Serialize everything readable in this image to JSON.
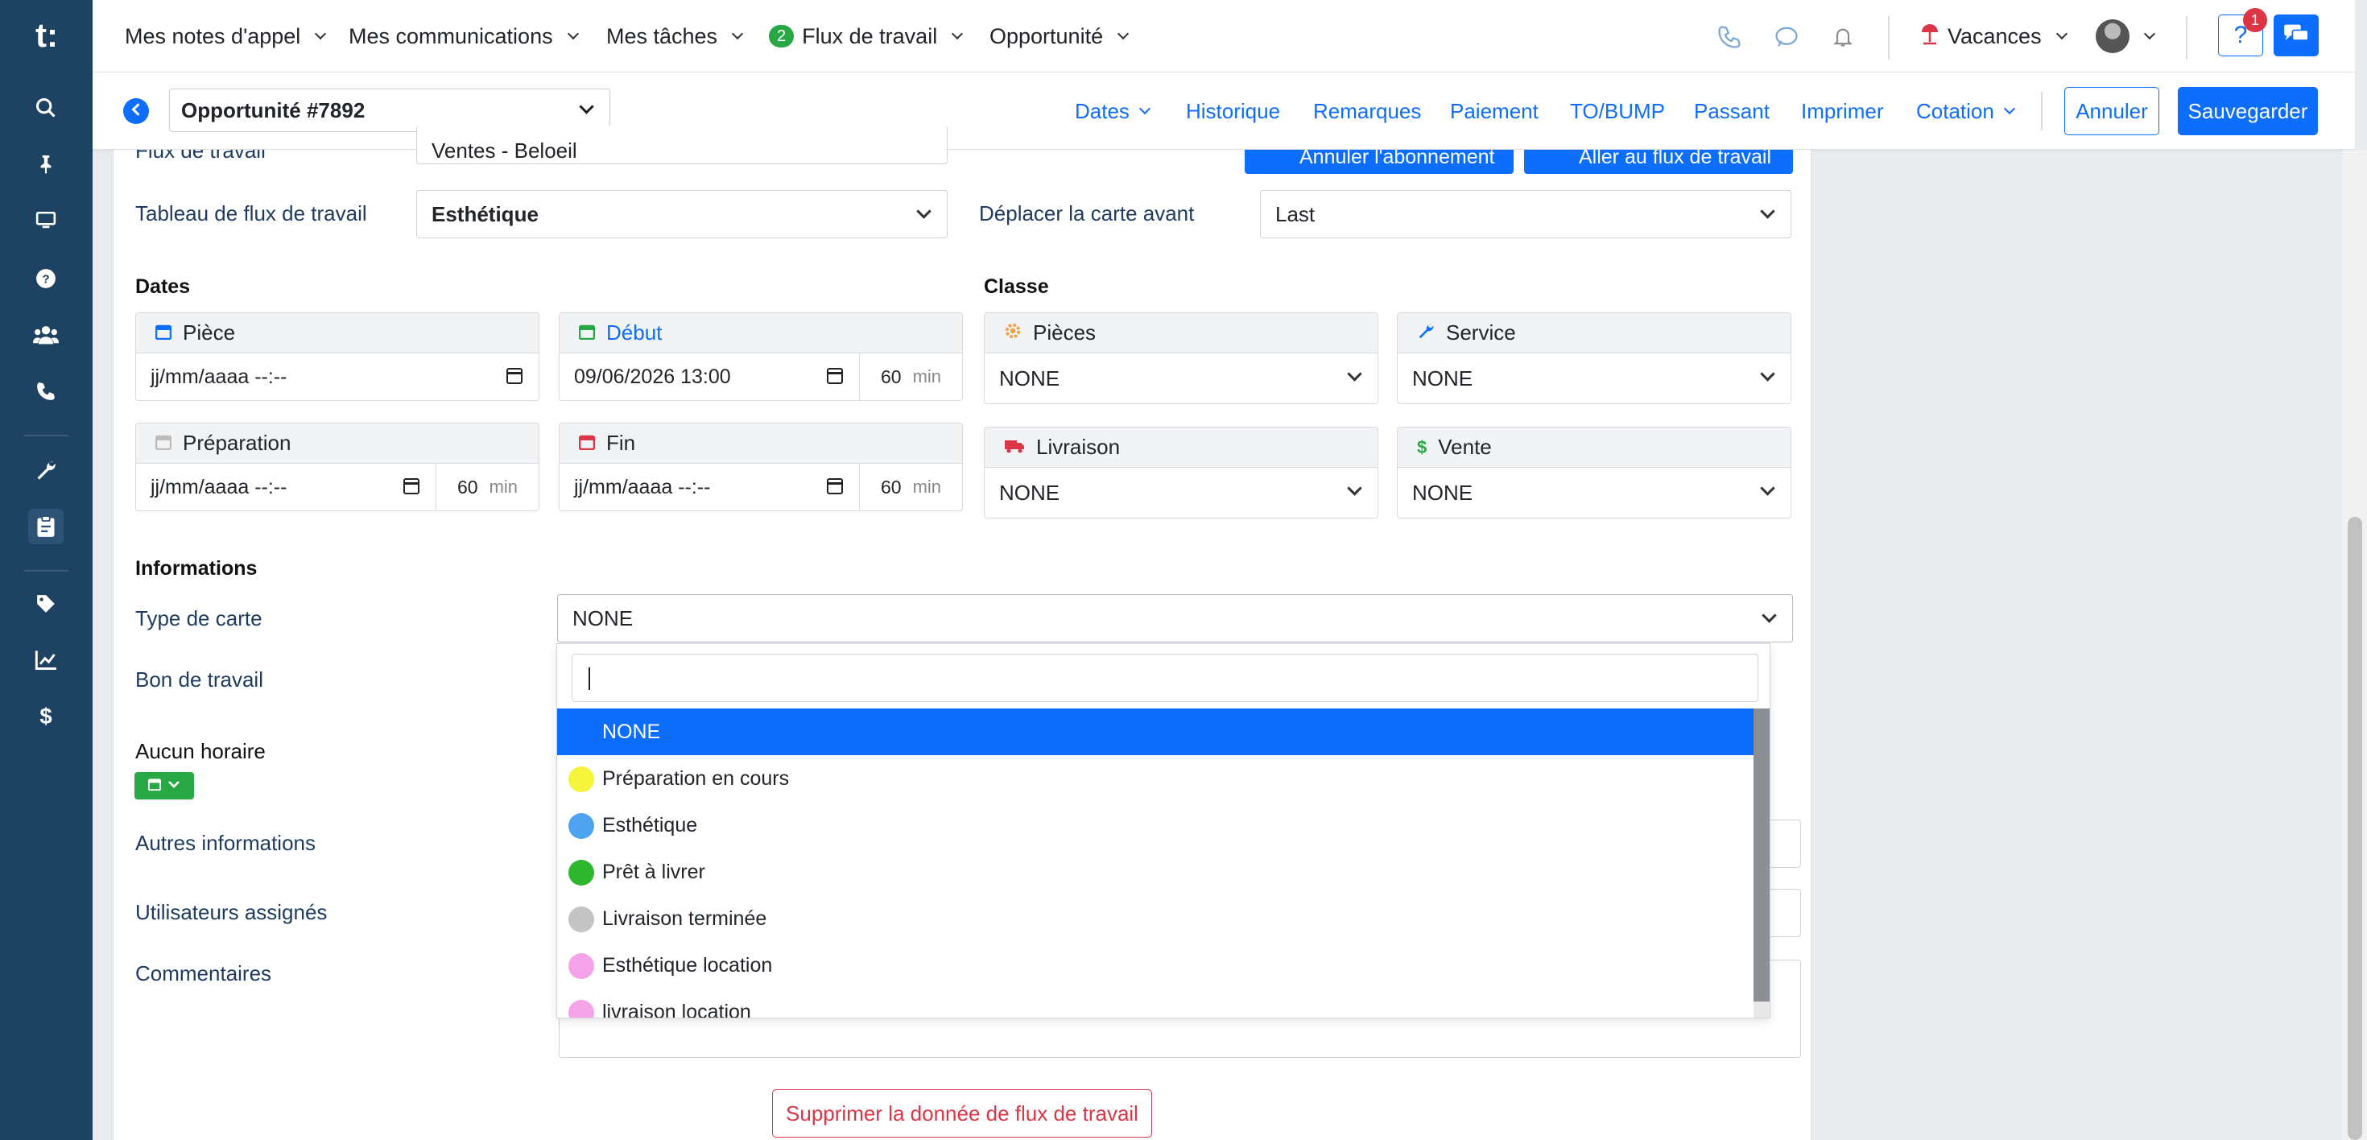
{
  "sidebar": {
    "logo": "t:",
    "icons": [
      "search-icon",
      "pin-icon",
      "monitor-icon",
      "help-circle-icon",
      "users-icon",
      "phone-icon",
      "wrench-icon",
      "clipboard-icon",
      "tag-icon",
      "chart-line-icon",
      "dollar-icon"
    ]
  },
  "topnav": {
    "items": [
      {
        "label": "Mes notes d'appel"
      },
      {
        "label": "Mes communications"
      },
      {
        "label": "Mes tâches"
      },
      {
        "label": "Flux de travail",
        "badge": "2"
      },
      {
        "label": "Opportunité"
      }
    ],
    "vacances": "Vacances",
    "help_badge": "1",
    "help_label": "?"
  },
  "subbar": {
    "opportunity": "Opportunité #7892",
    "links": [
      "Dates",
      "Historique",
      "Remarques",
      "Paiement",
      "TO/BUMP",
      "Passant",
      "Imprimer",
      "Cotation"
    ],
    "cancel": "Annuler",
    "save": "Sauvegarder"
  },
  "form": {
    "workflow_label": "Flux de travail",
    "workflow_value": "Ventes - Beloeil",
    "btn_cancel_sub": "Annuler l'abonnement",
    "btn_goto_flow": "Aller au flux de travail",
    "board_label": "Tableau de flux de travail",
    "board_value": "Esthétique",
    "move_label": "Déplacer la carte avant",
    "move_value": "Last",
    "dates_title": "Dates",
    "classe_title": "Classe",
    "piece": {
      "label": "Pièce",
      "value": "jj/mm/aaaa --:--"
    },
    "debut": {
      "label": "Début",
      "value": "09/06/2026 13:00",
      "minutes": "60",
      "unit": "min"
    },
    "preparation": {
      "label": "Préparation",
      "value": "jj/mm/aaaa --:--",
      "minutes": "60",
      "unit": "min"
    },
    "fin": {
      "label": "Fin",
      "value": "jj/mm/aaaa --:--",
      "minutes": "60",
      "unit": "min"
    },
    "pieces": {
      "label": "Pièces",
      "value": "NONE"
    },
    "service": {
      "label": "Service",
      "value": "NONE"
    },
    "livraison": {
      "label": "Livraison",
      "value": "NONE"
    },
    "vente": {
      "label": "Vente",
      "value": "NONE"
    },
    "info_title": "Informations",
    "card_type_label": "Type de carte",
    "card_type_value": "NONE",
    "work_order_label": "Bon de travail",
    "no_schedule_label": "Aucun horaire",
    "other_info_label": "Autres informations",
    "assigned_label": "Utilisateurs assignés",
    "comments_label": "Commentaires",
    "delete_btn": "Supprimer la donnée de flux de travail"
  },
  "dropdown": {
    "search_value": "",
    "options": [
      {
        "label": "NONE",
        "color": "",
        "selected": true
      },
      {
        "label": "Préparation en cours",
        "color": "#f5f53c"
      },
      {
        "label": "Esthétique",
        "color": "#4da3ef"
      },
      {
        "label": "Prêt à livrer",
        "color": "#2fb82f"
      },
      {
        "label": "Livraison terminée",
        "color": "#c4c4c4"
      },
      {
        "label": "Esthétique location",
        "color": "#f5a3e8"
      },
      {
        "label": "livraison location",
        "color": "#f5a3e8"
      }
    ]
  },
  "colors": {
    "primary": "#0d6efd",
    "sidebar": "#1e4262",
    "danger": "#dc3545",
    "success": "#28a745"
  }
}
